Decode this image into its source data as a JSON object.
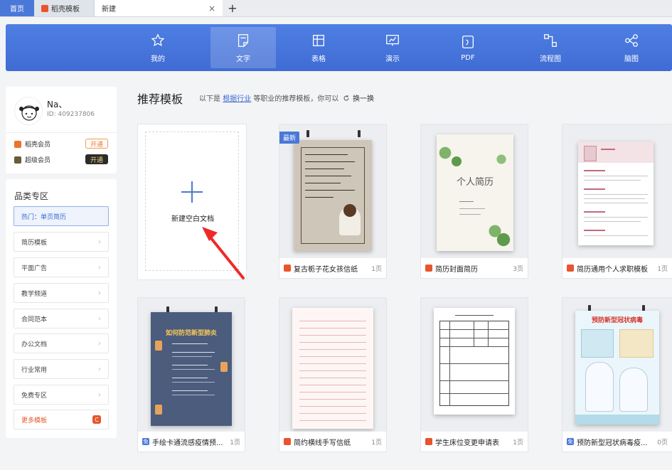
{
  "tabs": {
    "home": "首页",
    "docer": "稻壳模板",
    "new": "新建",
    "close": "×",
    "add": "+"
  },
  "categories": [
    {
      "label": "我的",
      "icon": "star-icon"
    },
    {
      "label": "文字",
      "icon": "doc-icon",
      "active": true
    },
    {
      "label": "表格",
      "icon": "table-icon"
    },
    {
      "label": "演示",
      "icon": "presentation-icon"
    },
    {
      "label": "PDF",
      "icon": "pdf-icon"
    },
    {
      "label": "流程图",
      "icon": "flowchart-icon"
    },
    {
      "label": "脑图",
      "icon": "mindmap-icon"
    }
  ],
  "user": {
    "name": "Na、",
    "id": "ID: 409237806"
  },
  "memberships": [
    {
      "label": "稻壳会员",
      "button": "开通"
    },
    {
      "label": "超级会员",
      "button": "开通"
    }
  ],
  "sidebar": {
    "title": "品类专区",
    "items": [
      "热门：单页简历",
      "简历模板",
      "平面广告",
      "教学频道",
      "合同范本",
      "办公文档",
      "行业常用",
      "免费专区",
      "更多模板"
    ],
    "chevron": "›",
    "more_badge": "C"
  },
  "main": {
    "title": "推荐模板",
    "subtext_prefix": "以下是",
    "subtext_link": "根据行业",
    "subtext_suffix": "等职业的推荐模板，你可以",
    "refresh": "换一换",
    "new_blank": "新建空白文档",
    "new_badge": "最新"
  },
  "templates": [
    {
      "name": "复古栀子花女孩信纸",
      "pages": "1页",
      "tag": "orange"
    },
    {
      "name": "简历封面简历",
      "pages": "3页",
      "tag": "orange"
    },
    {
      "name": "简历通用个人求职模板",
      "pages": "1页",
      "tag": "orange"
    },
    {
      "name": "手绘卡通流感疫情预...",
      "pages": "1页",
      "tag": "blue",
      "tag_text": "免"
    },
    {
      "name": "简约横线手写信纸",
      "pages": "1页",
      "tag": "orange"
    },
    {
      "name": "学生床位变更申请表",
      "pages": "1页",
      "tag": "orange"
    },
    {
      "name": "预防新型冠状病毒疫...",
      "pages": "0页",
      "tag": "blue",
      "tag_text": "免"
    }
  ],
  "thumb_text": {
    "resume_cover_title": "个人简历",
    "poster1_title": "如何防范新型肺炎",
    "poster2_title": "预防新型冠状病毒"
  },
  "colors": {
    "brand_blue": "#4a78d9",
    "docer_orange": "#e8542d"
  }
}
